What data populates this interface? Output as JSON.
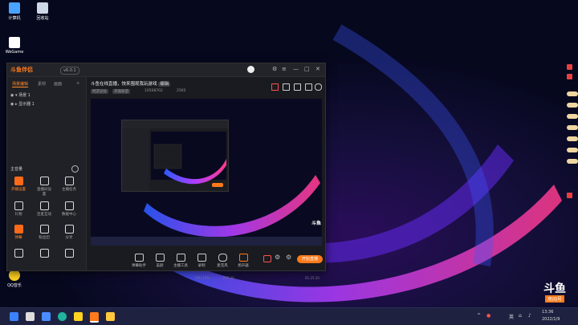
{
  "desktop": {
    "icons": [
      {
        "label": "计算机",
        "icon": "computer-icon",
        "color": "#4aa3ff"
      },
      {
        "label": "回收站",
        "icon": "recycle-bin-icon",
        "color": "#cfd8e6"
      },
      {
        "label": "WeGame",
        "icon": "wegame-icon",
        "color": "#ffffff"
      },
      {
        "label": "QQ音乐",
        "icon": "qq-music-icon",
        "color": "#ffd21f"
      }
    ]
  },
  "window": {
    "app_name": "斗鱼伴侣",
    "version": "v6.0.1",
    "tabs": [
      "场景编辑",
      "素材",
      "画面"
    ],
    "scenes": [
      "场景 1",
      "显示器 1"
    ],
    "volume_label": "主音量",
    "tools": [
      {
        "label": "开播设置",
        "hot": true
      },
      {
        "label": "直播间设置",
        "hot": false
      },
      {
        "label": "主播任务",
        "hot": false
      },
      {
        "label": "礼物",
        "hot": false
      },
      {
        "label": "连麦互动",
        "hot": false
      },
      {
        "label": "数据中心",
        "hot": false
      },
      {
        "label": "弹幕",
        "hot": true
      },
      {
        "label": "粉丝团",
        "hot": false
      },
      {
        "label": "分享",
        "hot": false
      }
    ],
    "room_title": "斗鱼在线直播，快来围观我玩游戏",
    "edit_label": "编辑",
    "room_category": "网游竞技",
    "room_sub": "英雄联盟",
    "room_id": "10508702",
    "viewers": "2565",
    "controls": [
      {
        "label": "弹幕助手",
        "icon": "danmu-icon"
      },
      {
        "label": "美颜",
        "icon": "beauty-icon"
      },
      {
        "label": "主播工具",
        "icon": "tools-icon"
      },
      {
        "label": "录制",
        "icon": "record-icon"
      },
      {
        "label": "麦克风",
        "icon": "mic-icon"
      },
      {
        "label": "扬声器",
        "icon": "speaker-icon"
      }
    ],
    "start_label": "开始直播",
    "status": {
      "cpu": "CPU 12%",
      "fps": "FPS 30",
      "time": "01:25:30"
    }
  },
  "taskbar": {
    "lang": "英",
    "time": "13:36",
    "date": "2022/1/9"
  },
  "watermark": {
    "brand": "斗鱼",
    "sub": "房间号",
    "room_no": "10508702"
  },
  "colors": {
    "accent": "#ff7a1a",
    "window_bg": "#1c1d22"
  }
}
